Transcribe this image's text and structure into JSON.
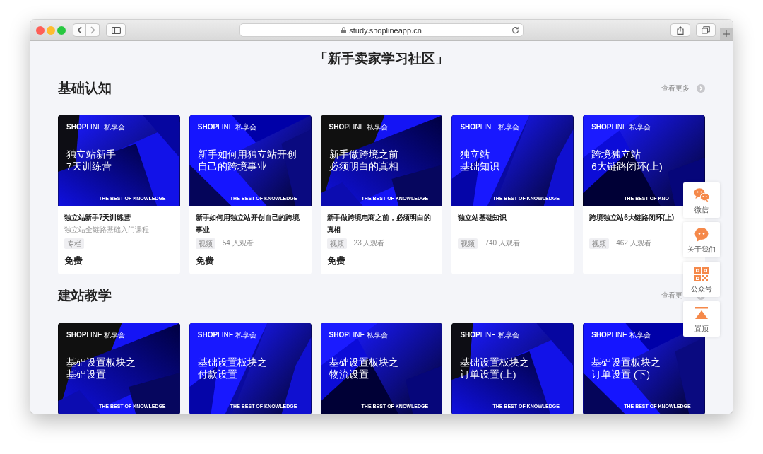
{
  "browser": {
    "url": "study.shoplineapp.cn"
  },
  "page_title": "「新手卖家学习社区」",
  "sections": [
    {
      "heading": "基础认知",
      "more_link": "查看更多",
      "cards": [
        {
          "cover": {
            "brand": "**SHOP**LINE 私享会",
            "title_lines": [
              "独立站新手",
              "7天训练营"
            ],
            "tagline": "THE BEST OF KNOWLEDGE"
          },
          "title": "独立站新手7天训练营",
          "subtitle": "独立站全链路基础入门课程",
          "tag": "专栏",
          "price": "免费"
        },
        {
          "cover": {
            "brand": "**SHOP**LINE 私享会",
            "title_lines": [
              "新手如何用独立站开创",
              "自己的跨境事业"
            ],
            "tagline": "THE BEST OF KNOWLEDGE"
          },
          "title": "新手如何用独立站开创自己的跨境事业",
          "tag": "视频",
          "views": "54 人观看",
          "price": "免费"
        },
        {
          "cover": {
            "brand": "**SHOP**LINE 私享会",
            "title_lines": [
              "新手做跨境之前",
              "必须明白的真相"
            ],
            "tagline": "THE BEST OF KNOWLEDGE"
          },
          "title": "新手做跨境电商之前，必须明白的真相",
          "tag": "视频",
          "views": "23 人观看",
          "price": "免费"
        },
        {
          "cover": {
            "brand": "**SHOP**LINE 私享会",
            "title_lines": [
              "独立站",
              "基础知识"
            ],
            "tagline": "THE BEST OF KNOWLEDGE"
          },
          "title": "独立站基础知识",
          "tag": "视频",
          "views": "740 人观看"
        },
        {
          "cover": {
            "brand": "**SHOP**LINE 私享会",
            "title_lines": [
              "跨境独立站",
              "6大链路闭环(上)"
            ],
            "tagline": "THE BEST OF KNO"
          },
          "title": "跨境独立站6大链路闭环(上)",
          "tag": "视频",
          "views": "462 人观看"
        }
      ]
    },
    {
      "heading": "建站教学",
      "more_link": "查看更",
      "cards": [
        {
          "cover": {
            "brand": "**SHOP**LINE 私享会",
            "title_lines": [
              "基础设置板块之",
              "基础设置"
            ],
            "tagline": "THE BEST OF KNOWLEDGE"
          }
        },
        {
          "cover": {
            "brand": "**SHOP**LINE 私享会",
            "title_lines": [
              "基础设置板块之",
              "付款设置"
            ],
            "tagline": "THE BEST OF KNOWLEDGE"
          }
        },
        {
          "cover": {
            "brand": "**SHOP**LINE 私享会",
            "title_lines": [
              "基础设置板块之",
              "物流设置"
            ],
            "tagline": "THE BEST OF KNOWLEDGE"
          }
        },
        {
          "cover": {
            "brand": "**SHOP**LINE 私享会",
            "title_lines": [
              "基础设置板块之",
              "订单设置(上)"
            ],
            "tagline": "THE BEST OF KNOWLEDGE"
          }
        },
        {
          "cover": {
            "brand": "**SHOP**LINE 私享会",
            "title_lines": [
              "基础设置板块之",
              "订单设置 (下)"
            ],
            "tagline": "THE BEST OF KNOWLEDGE"
          }
        }
      ]
    }
  ],
  "side_toolbar": [
    {
      "kind": "wechat",
      "label": "微信"
    },
    {
      "kind": "chat",
      "label": "关于我们"
    },
    {
      "kind": "qrcode",
      "label": "公众号"
    },
    {
      "kind": "top",
      "label": "置顶"
    }
  ]
}
